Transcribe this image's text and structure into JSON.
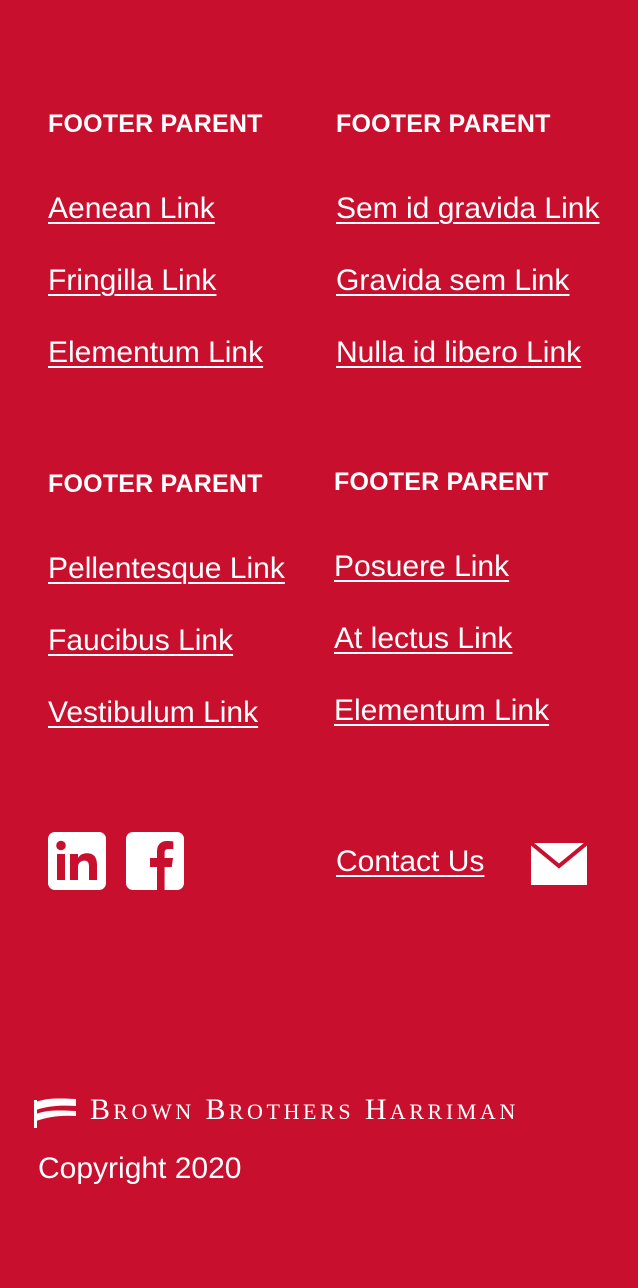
{
  "footer": {
    "columns": [
      {
        "heading": "FOOTER PARENT",
        "links": [
          "Aenean Link",
          "Fringilla Link",
          "Elementum Link"
        ]
      },
      {
        "heading": "FOOTER PARENT",
        "links": [
          "Sem id gravida Link",
          "Gravida sem Link",
          "Nulla id libero Link"
        ]
      },
      {
        "heading": "FOOTER PARENT",
        "links": [
          "Pellentesque Link",
          "Faucibus Link",
          "Vestibulum Link"
        ]
      },
      {
        "heading": "FOOTER PARENT",
        "links": [
          "Posuere Link",
          "At lectus Link",
          "Elementum Link"
        ]
      }
    ],
    "social": {
      "icons": [
        "linkedin-icon",
        "facebook-icon"
      ]
    },
    "contact": {
      "label": "Contact Us",
      "icon": "mail-icon"
    },
    "brand": {
      "name": "Brown Brothers Harriman",
      "logo_icon": "bbh-flag-icon"
    },
    "copyright": "Copyright 2020"
  },
  "colors": {
    "background": "#c8102e",
    "foreground": "#ffffff"
  }
}
